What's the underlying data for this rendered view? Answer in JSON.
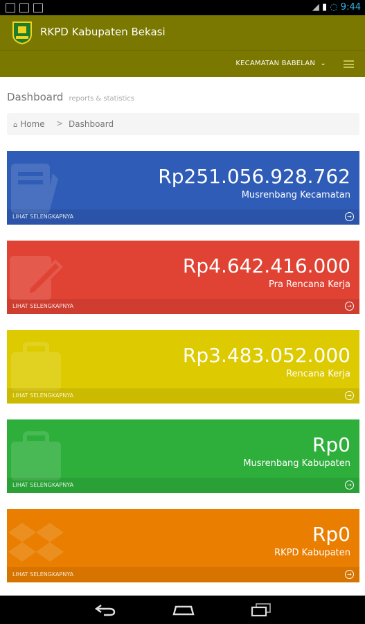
{
  "statusbar": {
    "time": "9:44"
  },
  "appbar": {
    "title": "RKPD Kabupaten Bekasi"
  },
  "subbar": {
    "district": "KECAMATAN BABELAN"
  },
  "page": {
    "title": "Dashboard",
    "subtitle": "reports & statistics"
  },
  "breadcrumb": {
    "home": "Home",
    "separator": ">",
    "current": "Dashboard"
  },
  "cards": [
    {
      "value": "Rp251.056.928.762",
      "label": "Musrenbang Kecamatan",
      "more": "LIHAT SELENGKAPNYA",
      "color": "#2f5cb7",
      "icon": "notebook-icon"
    },
    {
      "value": "Rp4.642.416.000",
      "label": "Pra Rencana Kerja",
      "more": "LIHAT SELENGKAPNYA",
      "color": "#e04334",
      "icon": "pencil-icon"
    },
    {
      "value": "Rp3.483.052.000",
      "label": "Rencana Kerja",
      "more": "LIHAT SELENGKAPNYA",
      "color": "#ddca00",
      "icon": "briefcase-icon"
    },
    {
      "value": "Rp0",
      "label": "Musrenbang Kabupaten",
      "more": "LIHAT SELENGKAPNYA",
      "color": "#2eaf3c",
      "icon": "briefcase-icon"
    },
    {
      "value": "Rp0",
      "label": "RKPD Kabupaten",
      "more": "LIHAT SELENGKAPNYA",
      "color": "#ea7e00",
      "icon": "dropbox-icon"
    }
  ]
}
